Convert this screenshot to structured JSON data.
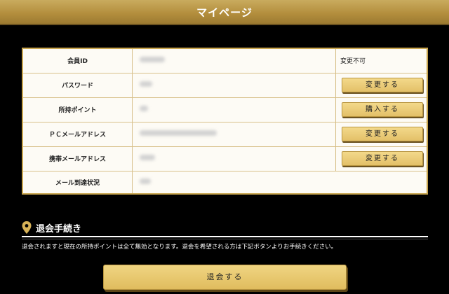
{
  "header": {
    "title": "マイページ"
  },
  "colors": {
    "gold": "#c9a64f",
    "header_gold": "#b48f3e",
    "background": "#000000"
  },
  "table": {
    "rows": [
      {
        "label": "会員ID",
        "action_type": "text",
        "action": "変更不可"
      },
      {
        "label": "パスワード",
        "action_type": "button",
        "action": "変更する"
      },
      {
        "label": "所持ポイント",
        "action_type": "button",
        "action": "購入する"
      },
      {
        "label": "ＰＣメールアドレス",
        "action_type": "button",
        "action": "変更する"
      },
      {
        "label": "携帯メールアドレス",
        "action_type": "button",
        "action": "変更する"
      },
      {
        "label": "メール到達状況",
        "action_type": "none",
        "action": ""
      }
    ]
  },
  "withdraw": {
    "icon": "map-pin-icon",
    "title": "退会手続き",
    "notice": "退会されますと現在の所持ポイントは全て無効となります。退会を希望される方は下記ボタンよりお手続きください。",
    "button_label": "退会する"
  }
}
